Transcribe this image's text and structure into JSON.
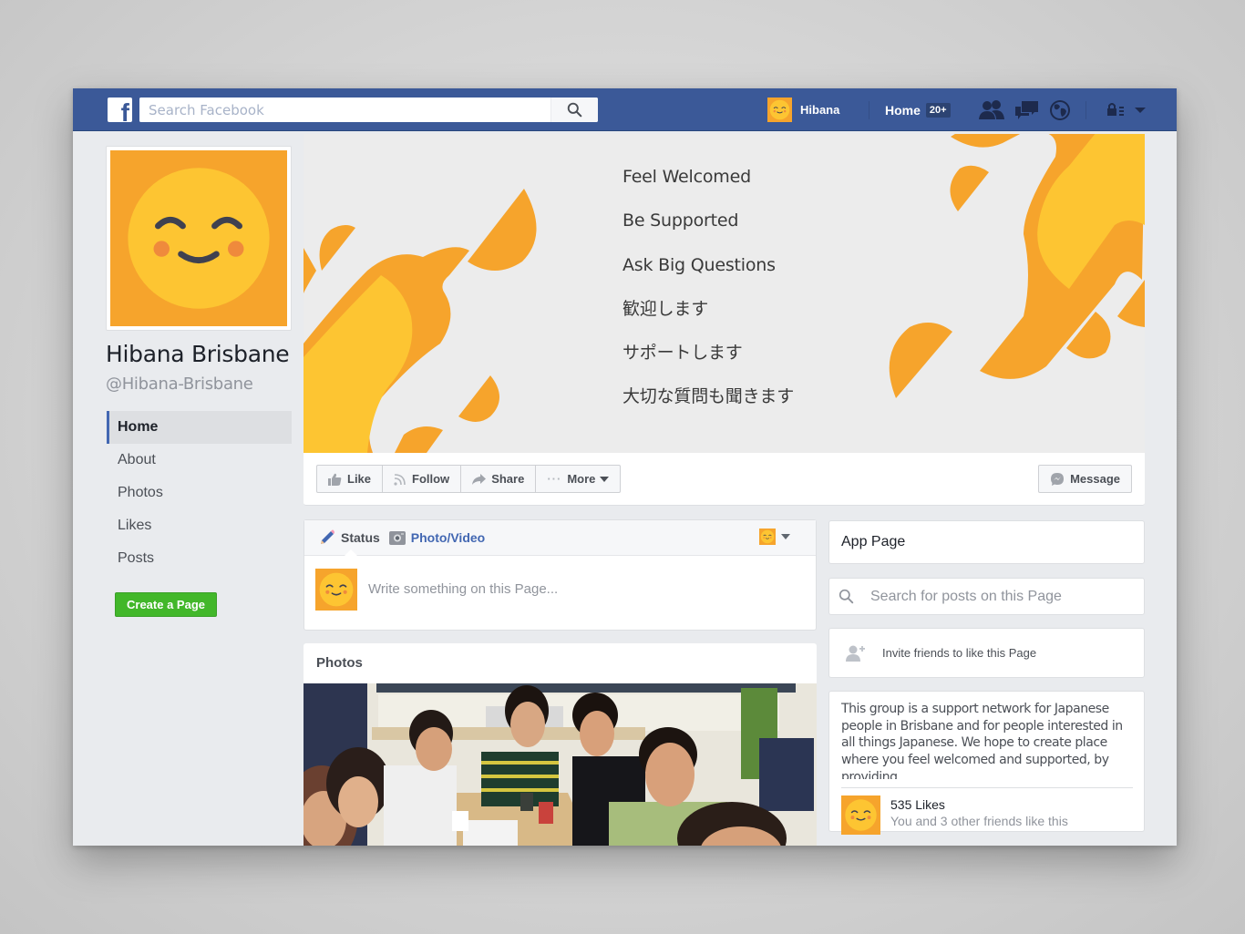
{
  "topbar": {
    "logo_glyph": "f",
    "search_placeholder": "Search Facebook",
    "profile_name": "Hibana",
    "home_label": "Home",
    "home_badge": "20+",
    "icons": [
      "friend-requests-icon",
      "messages-icon",
      "notifications-globe-icon",
      "privacy-lock-icon",
      "account-menu-chevron-icon"
    ],
    "brand_color": "#3b5998"
  },
  "page": {
    "name": "Hibana Brisbane",
    "handle": "@Hibana-Brisbane"
  },
  "leftnav": {
    "items": [
      {
        "label": "Home",
        "active": true
      },
      {
        "label": "About",
        "active": false
      },
      {
        "label": "Photos",
        "active": false
      },
      {
        "label": "Likes",
        "active": false
      },
      {
        "label": "Posts",
        "active": false
      }
    ],
    "create_page_label": "Create a Page"
  },
  "cover": {
    "lines": [
      "Feel Welcomed",
      "Be Supported",
      "Ask Big Questions",
      "歓迎します",
      "サポートします",
      "大切な質問も聞きます"
    ],
    "colors": {
      "orange": "#f6a42c",
      "yellow": "#fdc532",
      "background": "#ececec"
    }
  },
  "actions": {
    "like": "Like",
    "follow": "Follow",
    "share": "Share",
    "more": "More",
    "message": "Message"
  },
  "composer": {
    "tab_status": "Status",
    "tab_photo": "Photo/Video",
    "placeholder": "Write something on this Page..."
  },
  "photos": {
    "title": "Photos",
    "photo_description": "group photo of smiling people around a table"
  },
  "sidebar_right": {
    "app_page": "App Page",
    "search_placeholder": "Search for posts on this Page",
    "invite_label": "Invite friends to like this Page",
    "about_text": "This group is a support network for Japanese people in Brisbane and for people interested in all things Japanese. We hope to create place where you feel welcomed and supported, by providing",
    "likes_count": "535 Likes",
    "likes_friends": "You and 3 other friends like this"
  }
}
